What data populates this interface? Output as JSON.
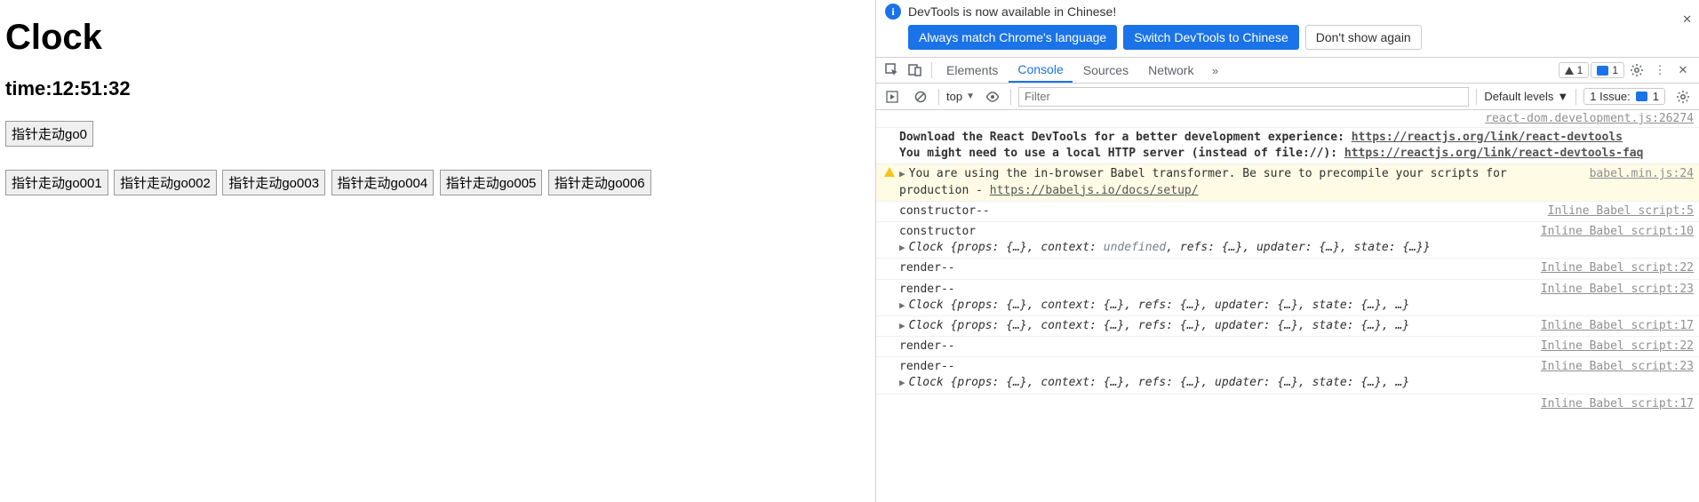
{
  "page": {
    "title": "Clock",
    "time_label_prefix": "time:",
    "time_value": "12:51:32",
    "button_row1": [
      "指针走动go0"
    ],
    "button_row2": [
      "指针走动go001",
      "指针走动go002",
      "指针走动go003",
      "指针走动go004",
      "指针走动go005",
      "指针走动go006"
    ]
  },
  "devtools": {
    "infobar": {
      "message": "DevTools is now available in Chinese!",
      "primary1": "Always match Chrome's language",
      "primary2": "Switch DevTools to Chinese",
      "secondary": "Don't show again"
    },
    "tabs": {
      "elements": "Elements",
      "console": "Console",
      "sources": "Sources",
      "network": "Network"
    },
    "warning_count": "1",
    "issue_count": "1",
    "filter": {
      "context": "top",
      "placeholder": "Filter",
      "levels": "Default levels",
      "issues_label": "1 Issue:",
      "issues_count": "1"
    },
    "messages": {
      "src_top": "react-dom.development.js:26274",
      "m1_a": "Download the React DevTools for a better development experience: ",
      "m1_link1": "https://reactjs.org/link/react-devtools",
      "m1_b": "You might need to use a local HTTP server (instead of file://): ",
      "m1_link2": "https://reactjs.org/link/react-devtools-faq",
      "warn_text": "You are using the in-browser Babel transformer. Be sure to precompile your scripts for production - ",
      "warn_link": "https://babeljs.io/docs/setup/",
      "warn_src": "babel.min.js:24",
      "c1_text": "constructor--",
      "c1_src": "Inline Babel script:5",
      "c2_text": "constructor",
      "c2_src": "Inline Babel script:10",
      "obj_short": "Clock {props: {…}, context: ",
      "obj_undef": "undefined",
      "obj_short2": ", refs: {…}, updater: {…}, state: {…}}",
      "r1_text": "render--",
      "r1_src": "Inline Babel script:22",
      "r2_text": "render--",
      "r2_src": "Inline Babel script:23",
      "obj_full": "Clock {props: {…}, context: {…}, refs: {…}, updater: {…}, state: {…}, …}",
      "src17": "Inline Babel script:17"
    }
  }
}
